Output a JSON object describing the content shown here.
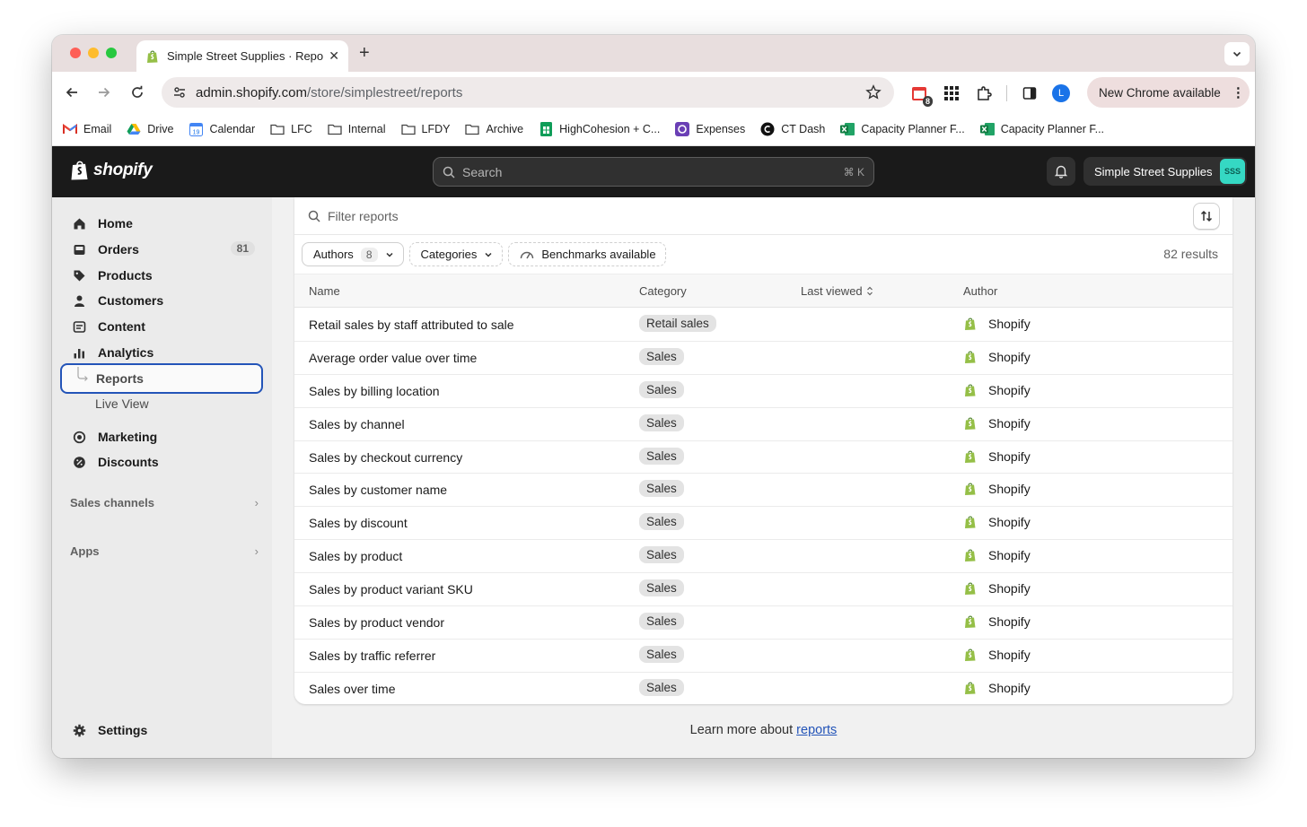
{
  "browser": {
    "tab_title": "Simple Street Supplies · Repo",
    "tab_close": "✕",
    "new_tab": "+",
    "url_host": "admin.shopify.com",
    "url_path": "/store/simplestreet/reports",
    "extension_badge": "8",
    "profile_initial": "L",
    "update_label": "New Chrome available",
    "update_menu": "⋮"
  },
  "bookmarks": [
    {
      "label": "Email",
      "icon": "gmail-icon"
    },
    {
      "label": "Drive",
      "icon": "drive-icon"
    },
    {
      "label": "Calendar",
      "icon": "calendar-icon"
    },
    {
      "label": "LFC",
      "icon": "folder-icon"
    },
    {
      "label": "Internal",
      "icon": "folder-icon"
    },
    {
      "label": "LFDY",
      "icon": "folder-icon"
    },
    {
      "label": "Archive",
      "icon": "folder-icon"
    },
    {
      "label": "HighCohesion + C...",
      "icon": "sheets-icon"
    },
    {
      "label": "Expenses",
      "icon": "expenses-icon"
    },
    {
      "label": "CT Dash",
      "icon": "ct-icon"
    },
    {
      "label": "Capacity Planner F...",
      "icon": "excel-icon"
    },
    {
      "label": "Capacity Planner F...",
      "icon": "excel-icon"
    }
  ],
  "shopify": {
    "logo_text": "shopify",
    "search_placeholder": "Search",
    "search_shortcut": "⌘ K",
    "store_name": "Simple Street Supplies",
    "store_initials": "SSS"
  },
  "sidebar": {
    "items": [
      {
        "label": "Home",
        "icon": "home-icon"
      },
      {
        "label": "Orders",
        "icon": "orders-icon",
        "count": "81"
      },
      {
        "label": "Products",
        "icon": "tag-icon"
      },
      {
        "label": "Customers",
        "icon": "person-icon"
      },
      {
        "label": "Content",
        "icon": "content-icon"
      },
      {
        "label": "Analytics",
        "icon": "bar-chart-icon"
      }
    ],
    "sub_items": [
      {
        "label": "Reports"
      },
      {
        "label": "Live View"
      }
    ],
    "items2": [
      {
        "label": "Marketing",
        "icon": "target-icon"
      },
      {
        "label": "Discounts",
        "icon": "discount-icon"
      }
    ],
    "sales_channels": "Sales channels",
    "apps": "Apps",
    "settings": "Settings",
    "chevron": "›"
  },
  "reports": {
    "filter_placeholder": "Filter reports",
    "chips": {
      "authors_label": "Authors",
      "authors_count": "8",
      "categories_label": "Categories",
      "benchmarks_label": "Benchmarks available"
    },
    "results": "82 results",
    "columns": {
      "name": "Name",
      "category": "Category",
      "last_viewed": "Last viewed",
      "author": "Author"
    },
    "rows": [
      {
        "name": "Retail sales by staff attributed to sale",
        "category": "Retail sales",
        "author": "Shopify"
      },
      {
        "name": "Average order value over time",
        "category": "Sales",
        "author": "Shopify"
      },
      {
        "name": "Sales by billing location",
        "category": "Sales",
        "author": "Shopify"
      },
      {
        "name": "Sales by channel",
        "category": "Sales",
        "author": "Shopify"
      },
      {
        "name": "Sales by checkout currency",
        "category": "Sales",
        "author": "Shopify"
      },
      {
        "name": "Sales by customer name",
        "category": "Sales",
        "author": "Shopify"
      },
      {
        "name": "Sales by discount",
        "category": "Sales",
        "author": "Shopify"
      },
      {
        "name": "Sales by product",
        "category": "Sales",
        "author": "Shopify"
      },
      {
        "name": "Sales by product variant SKU",
        "category": "Sales",
        "author": "Shopify"
      },
      {
        "name": "Sales by product vendor",
        "category": "Sales",
        "author": "Shopify"
      },
      {
        "name": "Sales by traffic referrer",
        "category": "Sales",
        "author": "Shopify"
      },
      {
        "name": "Sales over time",
        "category": "Sales",
        "author": "Shopify"
      }
    ],
    "learn_prefix": "Learn more about ",
    "learn_link": "reports"
  },
  "colors": {
    "shopify_green": "#95bf47",
    "topbar": "#1a1a1a",
    "selected_border": "#2354b8"
  }
}
